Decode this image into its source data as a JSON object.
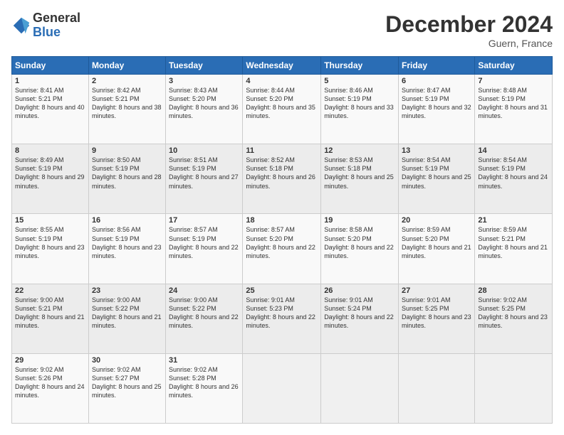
{
  "logo": {
    "general": "General",
    "blue": "Blue"
  },
  "header": {
    "title": "December 2024",
    "location": "Guern, France"
  },
  "weekdays": [
    "Sunday",
    "Monday",
    "Tuesday",
    "Wednesday",
    "Thursday",
    "Friday",
    "Saturday"
  ],
  "weeks": [
    [
      {
        "day": "1",
        "sunrise": "8:41 AM",
        "sunset": "5:21 PM",
        "daylight": "8 hours and 40 minutes."
      },
      {
        "day": "2",
        "sunrise": "8:42 AM",
        "sunset": "5:21 PM",
        "daylight": "8 hours and 38 minutes."
      },
      {
        "day": "3",
        "sunrise": "8:43 AM",
        "sunset": "5:20 PM",
        "daylight": "8 hours and 36 minutes."
      },
      {
        "day": "4",
        "sunrise": "8:44 AM",
        "sunset": "5:20 PM",
        "daylight": "8 hours and 35 minutes."
      },
      {
        "day": "5",
        "sunrise": "8:46 AM",
        "sunset": "5:19 PM",
        "daylight": "8 hours and 33 minutes."
      },
      {
        "day": "6",
        "sunrise": "8:47 AM",
        "sunset": "5:19 PM",
        "daylight": "8 hours and 32 minutes."
      },
      {
        "day": "7",
        "sunrise": "8:48 AM",
        "sunset": "5:19 PM",
        "daylight": "8 hours and 31 minutes."
      }
    ],
    [
      {
        "day": "8",
        "sunrise": "8:49 AM",
        "sunset": "5:19 PM",
        "daylight": "8 hours and 29 minutes."
      },
      {
        "day": "9",
        "sunrise": "8:50 AM",
        "sunset": "5:19 PM",
        "daylight": "8 hours and 28 minutes."
      },
      {
        "day": "10",
        "sunrise": "8:51 AM",
        "sunset": "5:19 PM",
        "daylight": "8 hours and 27 minutes."
      },
      {
        "day": "11",
        "sunrise": "8:52 AM",
        "sunset": "5:18 PM",
        "daylight": "8 hours and 26 minutes."
      },
      {
        "day": "12",
        "sunrise": "8:53 AM",
        "sunset": "5:18 PM",
        "daylight": "8 hours and 25 minutes."
      },
      {
        "day": "13",
        "sunrise": "8:54 AM",
        "sunset": "5:19 PM",
        "daylight": "8 hours and 25 minutes."
      },
      {
        "day": "14",
        "sunrise": "8:54 AM",
        "sunset": "5:19 PM",
        "daylight": "8 hours and 24 minutes."
      }
    ],
    [
      {
        "day": "15",
        "sunrise": "8:55 AM",
        "sunset": "5:19 PM",
        "daylight": "8 hours and 23 minutes."
      },
      {
        "day": "16",
        "sunrise": "8:56 AM",
        "sunset": "5:19 PM",
        "daylight": "8 hours and 23 minutes."
      },
      {
        "day": "17",
        "sunrise": "8:57 AM",
        "sunset": "5:19 PM",
        "daylight": "8 hours and 22 minutes."
      },
      {
        "day": "18",
        "sunrise": "8:57 AM",
        "sunset": "5:20 PM",
        "daylight": "8 hours and 22 minutes."
      },
      {
        "day": "19",
        "sunrise": "8:58 AM",
        "sunset": "5:20 PM",
        "daylight": "8 hours and 22 minutes."
      },
      {
        "day": "20",
        "sunrise": "8:59 AM",
        "sunset": "5:20 PM",
        "daylight": "8 hours and 21 minutes."
      },
      {
        "day": "21",
        "sunrise": "8:59 AM",
        "sunset": "5:21 PM",
        "daylight": "8 hours and 21 minutes."
      }
    ],
    [
      {
        "day": "22",
        "sunrise": "9:00 AM",
        "sunset": "5:21 PM",
        "daylight": "8 hours and 21 minutes."
      },
      {
        "day": "23",
        "sunrise": "9:00 AM",
        "sunset": "5:22 PM",
        "daylight": "8 hours and 21 minutes."
      },
      {
        "day": "24",
        "sunrise": "9:00 AM",
        "sunset": "5:22 PM",
        "daylight": "8 hours and 22 minutes."
      },
      {
        "day": "25",
        "sunrise": "9:01 AM",
        "sunset": "5:23 PM",
        "daylight": "8 hours and 22 minutes."
      },
      {
        "day": "26",
        "sunrise": "9:01 AM",
        "sunset": "5:24 PM",
        "daylight": "8 hours and 22 minutes."
      },
      {
        "day": "27",
        "sunrise": "9:01 AM",
        "sunset": "5:25 PM",
        "daylight": "8 hours and 23 minutes."
      },
      {
        "day": "28",
        "sunrise": "9:02 AM",
        "sunset": "5:25 PM",
        "daylight": "8 hours and 23 minutes."
      }
    ],
    [
      {
        "day": "29",
        "sunrise": "9:02 AM",
        "sunset": "5:26 PM",
        "daylight": "8 hours and 24 minutes."
      },
      {
        "day": "30",
        "sunrise": "9:02 AM",
        "sunset": "5:27 PM",
        "daylight": "8 hours and 25 minutes."
      },
      {
        "day": "31",
        "sunrise": "9:02 AM",
        "sunset": "5:28 PM",
        "daylight": "8 hours and 26 minutes."
      },
      null,
      null,
      null,
      null
    ]
  ]
}
